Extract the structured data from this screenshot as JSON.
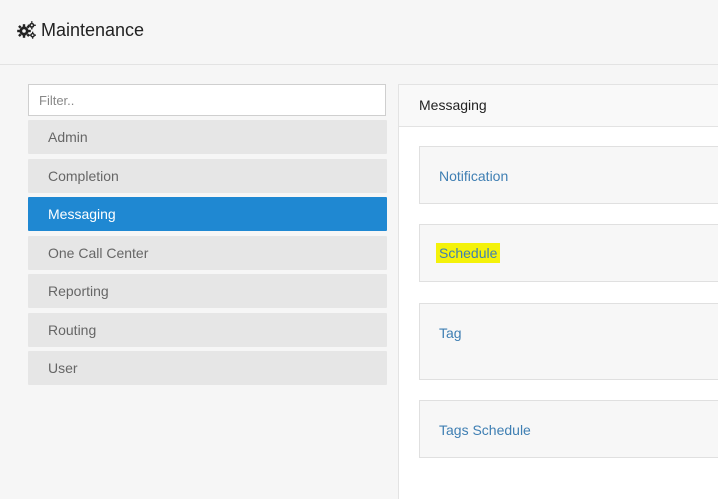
{
  "header": {
    "title": "Maintenance",
    "icon": "gears-icon"
  },
  "sidebar": {
    "filter": {
      "placeholder": "Filter..",
      "value": ""
    },
    "items": [
      {
        "label": "Admin",
        "active": false
      },
      {
        "label": "Completion",
        "active": false
      },
      {
        "label": "Messaging",
        "active": true
      },
      {
        "label": "One Call Center",
        "active": false
      },
      {
        "label": "Reporting",
        "active": false
      },
      {
        "label": "Routing",
        "active": false
      },
      {
        "label": "User",
        "active": false
      }
    ]
  },
  "panel": {
    "title": "Messaging",
    "cards": [
      {
        "label": "Notification",
        "highlighted": false
      },
      {
        "label": "Schedule",
        "highlighted": true
      },
      {
        "label": "Tag",
        "highlighted": false
      },
      {
        "label": "Tags Schedule",
        "highlighted": false
      }
    ]
  },
  "colors": {
    "accent": "#1f88d2",
    "link": "#3f7fb3",
    "highlight": "#f4f20a",
    "nav_bg": "#e6e6e6"
  }
}
